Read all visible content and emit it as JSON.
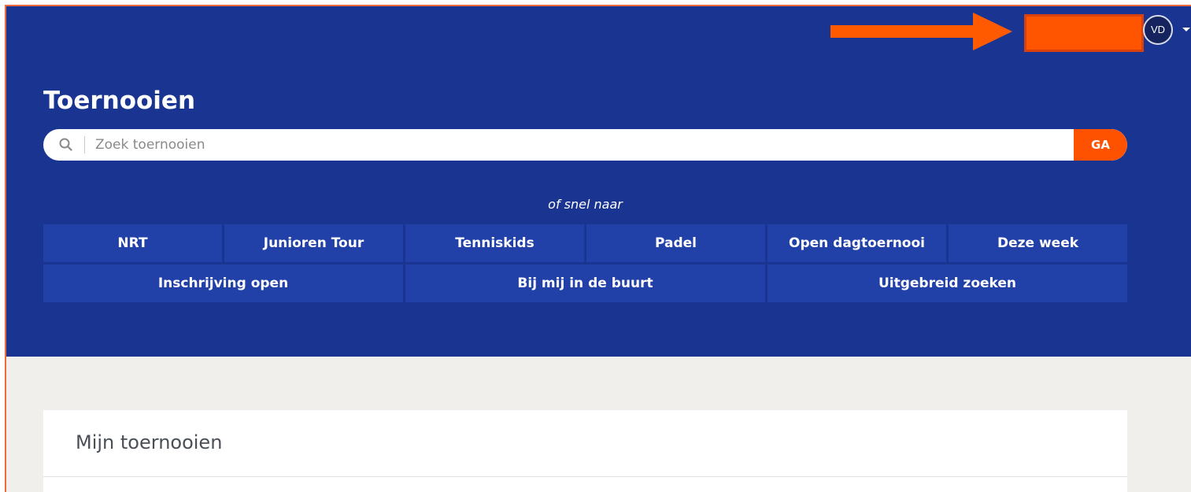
{
  "header": {
    "user": {
      "initials": "VD"
    }
  },
  "hero": {
    "title": "Toernooien",
    "search": {
      "placeholder": "Zoek toernooien",
      "value": "",
      "button_label": "GA"
    },
    "quick_links_caption": "of snel naar",
    "quick_links": {
      "row1": [
        "NRT",
        "Junioren Tour",
        "Tenniskids",
        "Padel",
        "Open dagtoernooi",
        "Deze week"
      ],
      "row2": [
        "Inschrijving open",
        "Bij mij in de buurt",
        "Uitgebreid zoeken"
      ]
    }
  },
  "my_tournaments": {
    "title": "Mijn toernooien"
  },
  "colors": {
    "hero_bg": "#1a3491",
    "quick_link_bg": "#2140a8",
    "accent": "#ff5200",
    "page_bg": "#f0efec",
    "annotation": "#ff5a00"
  },
  "icons": {
    "search": "search-icon",
    "avatar_caret": "caret-down-icon",
    "annotation_arrow": "arrow-right-icon"
  }
}
